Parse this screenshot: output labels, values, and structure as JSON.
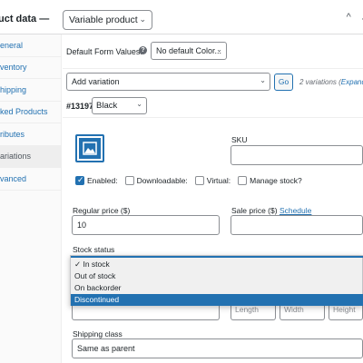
{
  "header": {
    "title": "uct data —",
    "product_type": "Variable product",
    "actions": [
      "^",
      "⌄"
    ]
  },
  "sidebar": {
    "items": [
      {
        "label": "eneral",
        "active": false
      },
      {
        "label": "ventory",
        "active": false
      },
      {
        "label": "hipping",
        "active": false
      },
      {
        "label": "ked Products",
        "active": false
      },
      {
        "label": "ributes",
        "active": false
      },
      {
        "label": "ariations",
        "active": true
      },
      {
        "label": "vanced",
        "active": false
      }
    ]
  },
  "defaults": {
    "label": "Default Form Values:",
    "help_icon": "?",
    "select_value": "No default Color..."
  },
  "add_variation": {
    "select_value": "Add variation",
    "go_label": "Go",
    "count_text": "2 variations (",
    "expand_link": "Expand /"
  },
  "variation": {
    "id": "#13197",
    "color": "Black",
    "image_icon": "image-placeholder-icon",
    "sku_label": "SKU",
    "sku_value": "",
    "checkboxes": [
      {
        "label": "Enabled:",
        "checked": true
      },
      {
        "label": "Downloadable:",
        "checked": false
      },
      {
        "label": "Virtual:",
        "checked": false
      },
      {
        "label": "Manage stock?",
        "checked": false
      }
    ],
    "regular_price_label": "Regular price ($)",
    "regular_price_value": "10",
    "sale_price_label": "Sale price ($)",
    "schedule_link": "Schedule",
    "sale_price_value": "",
    "stock_status_label": "Stock status",
    "dimension_placeholders": {
      "length": "Length",
      "width": "Width",
      "height": "Height"
    },
    "shipping_class_label": "Shipping class",
    "shipping_class_value": "Same as parent"
  },
  "stock_dropdown": {
    "options": [
      {
        "label": "✓ In stock",
        "highlighted": false
      },
      {
        "label": "Out of stock",
        "highlighted": false
      },
      {
        "label": "On backorder",
        "highlighted": false
      },
      {
        "label": "Discontinued",
        "highlighted": true
      }
    ]
  },
  "colors": {
    "accent": "#2271b1",
    "link": "#2271b1",
    "text": "#1d2327",
    "border": "#8c8f94"
  }
}
